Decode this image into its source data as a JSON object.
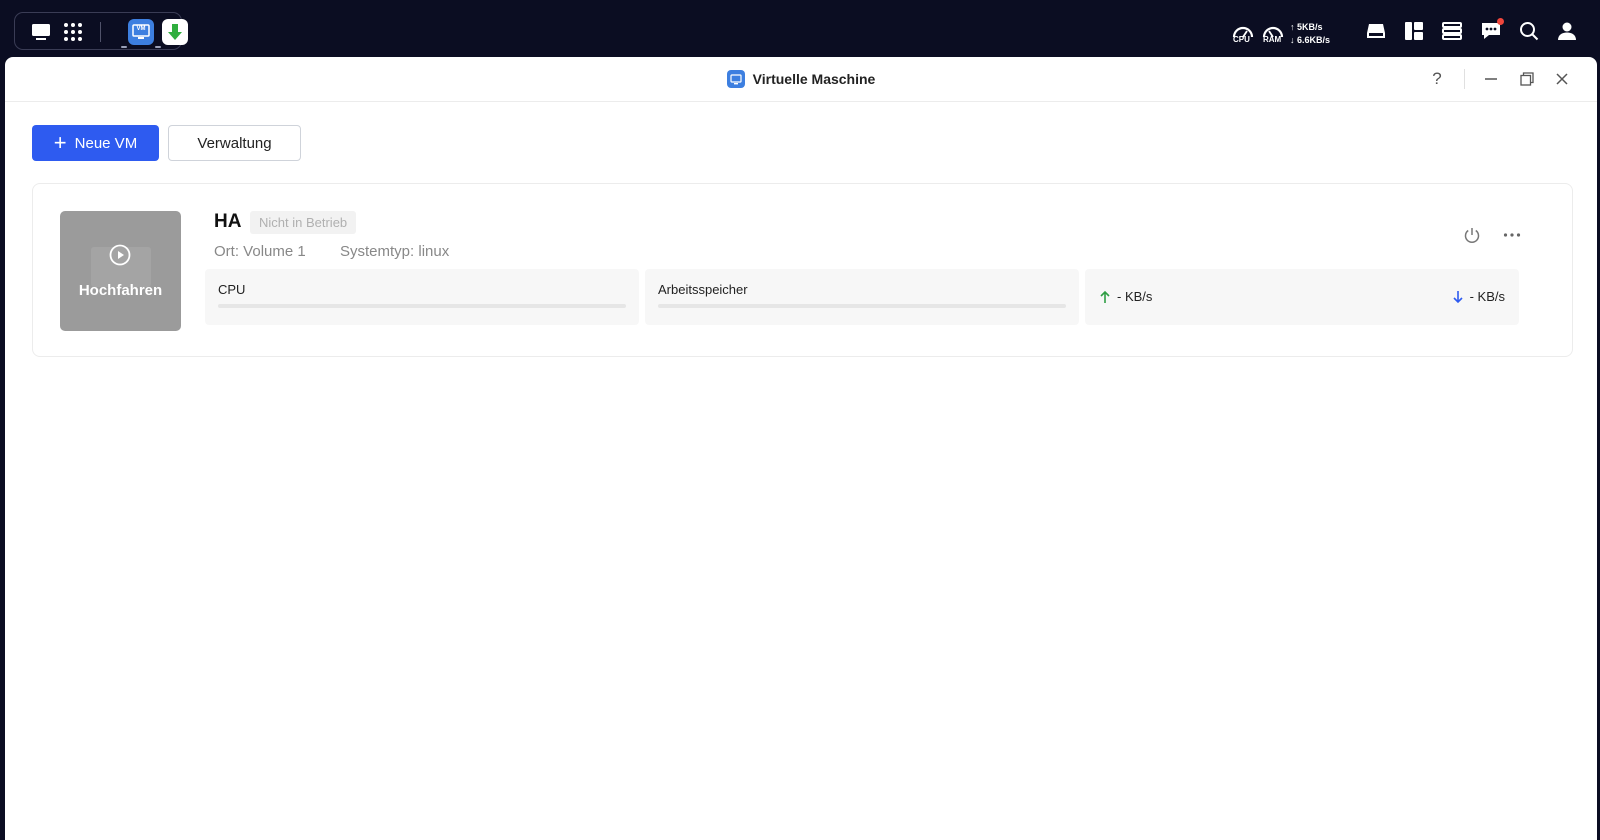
{
  "taskbar": {
    "dock_icons": [
      "desktop-icon",
      "app-grid-icon",
      "virtual-machine-app-icon",
      "download-app-icon"
    ],
    "vm_app_icon_text": "VM",
    "cpu_label": "CPU",
    "ram_label": "RAM",
    "upload_speed": "5KB/s",
    "download_speed": "6.6KB/s",
    "notification_badge_color": "#f0463c"
  },
  "window": {
    "title": "Virtuelle Maschine",
    "help_label": "?"
  },
  "toolbar": {
    "new_vm_label": "Neue VM",
    "admin_label": "Verwaltung"
  },
  "vm": {
    "name": "HA",
    "status": "Nicht in Betrieb",
    "start_label": "Hochfahren",
    "location_label": "Ort:",
    "location_value": "Volume 1",
    "system_type_label": "Systemtyp:",
    "system_type_value": "linux",
    "cpu_label": "CPU",
    "cpu_usage": 0,
    "memory_label": "Arbeitsspeicher",
    "memory_usage": 0,
    "net_up": "- KB/s",
    "net_down": "- KB/s"
  },
  "colors": {
    "accent": "#2e5bf0",
    "desktop_bg": "#0b0d22",
    "up_arrow": "#2f9e44",
    "down_arrow": "#2e5bf0"
  }
}
